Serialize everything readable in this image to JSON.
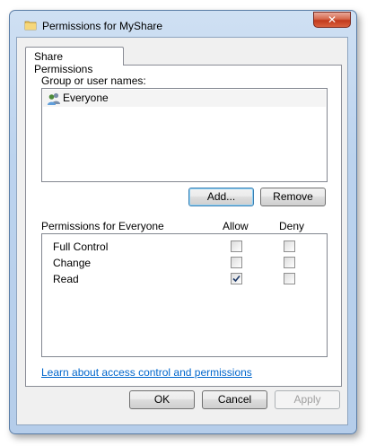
{
  "window": {
    "title": "Permissions for MyShare",
    "close_label": "✕"
  },
  "tab": {
    "label": "Share Permissions"
  },
  "users": {
    "label": "Group or user names:",
    "items": [
      {
        "name": "Everyone",
        "icon": "users-group-icon"
      }
    ],
    "add_label": "Add...",
    "remove_label": "Remove"
  },
  "permissions": {
    "label": "Permissions for Everyone",
    "allow_header": "Allow",
    "deny_header": "Deny",
    "rows": [
      {
        "name": "Full Control",
        "allow": false,
        "deny": false
      },
      {
        "name": "Change",
        "allow": false,
        "deny": false
      },
      {
        "name": "Read",
        "allow": true,
        "deny": false
      }
    ]
  },
  "help_link": "Learn about access control and permissions",
  "footer": {
    "ok_label": "OK",
    "cancel_label": "Cancel",
    "apply_label": "Apply"
  }
}
